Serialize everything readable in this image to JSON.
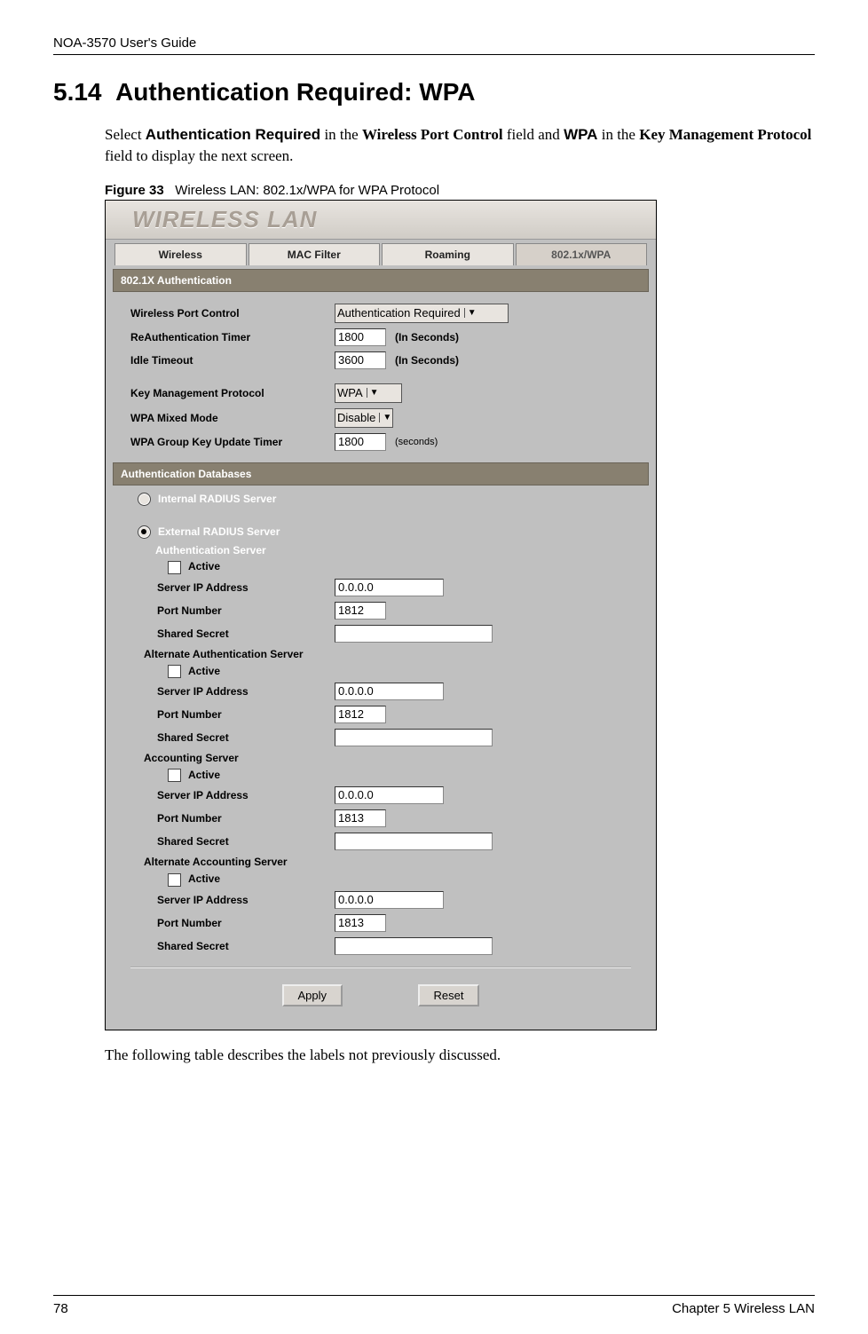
{
  "doc_header": "NOA-3570 User's Guide",
  "section_number": "5.14",
  "section_title": "Authentication Required: WPA",
  "intro_pre": "Select ",
  "intro_b1": "Authentication Required",
  "intro_mid1": " in the ",
  "intro_b2": "Wireless Port Control",
  "intro_mid2": " field and ",
  "intro_b3": "WPA",
  "intro_mid3": " in the ",
  "intro_b4": "Key Management Protocol",
  "intro_end": " field to display the next screen.",
  "figure_label": "Figure 33",
  "figure_caption": "Wireless LAN: 802.1x/WPA for WPA Protocol",
  "outro": "The following table describes the labels not previously discussed.",
  "footer_left": "78",
  "footer_right": "Chapter 5 Wireless LAN",
  "shot": {
    "title": "WIRELESS LAN",
    "tabs": [
      "Wireless",
      "MAC Filter",
      "Roaming",
      "802.1x/WPA"
    ],
    "hdr_auth": "802.1X Authentication",
    "row_wpc": "Wireless Port Control",
    "val_wpc": "Authentication Required",
    "row_reauth": "ReAuthentication Timer",
    "val_reauth": "1800",
    "unit_sec": "(In Seconds)",
    "row_idle": "Idle Timeout",
    "val_idle": "3600",
    "row_kmp": "Key Management Protocol",
    "val_kmp": "WPA",
    "row_mixed": "WPA Mixed Mode",
    "val_mixed": "Disable",
    "row_gkt": "WPA Group Key Update Timer",
    "val_gkt": "1800",
    "unit_sec2": "(seconds)",
    "hdr_adb": "Authentication Databases",
    "radio_internal": "Internal RADIUS Server",
    "radio_external": "External RADIUS Server",
    "sub_authserver": "Authentication Server",
    "lbl_active": "Active",
    "lbl_ip": "Server IP Address",
    "lbl_port": "Port Number",
    "lbl_secret": "Shared Secret",
    "sub_altauth": "Alternate Authentication Server",
    "sub_acct": "Accounting Server",
    "sub_altacct": "Alternate Accounting Server",
    "authserver": {
      "ip": "0.0.0.0",
      "port": "1812",
      "secret": ""
    },
    "altauth": {
      "ip": "0.0.0.0",
      "port": "1812",
      "secret": ""
    },
    "acct": {
      "ip": "0.0.0.0",
      "port": "1813",
      "secret": ""
    },
    "altacct": {
      "ip": "0.0.0.0",
      "port": "1813",
      "secret": ""
    },
    "btn_apply": "Apply",
    "btn_reset": "Reset"
  }
}
